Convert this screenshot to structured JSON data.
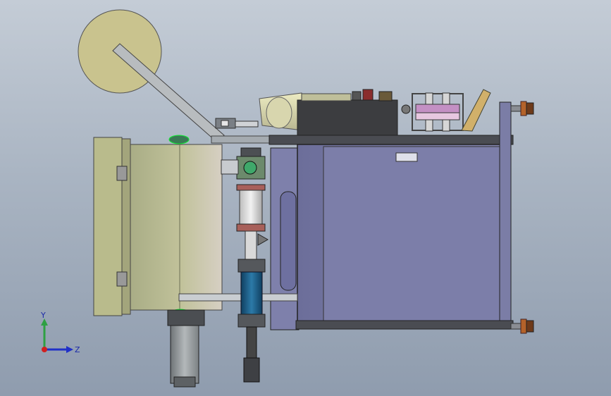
{
  "view": {
    "triad": {
      "y_label": "Y",
      "z_label": "Z",
      "y_color": "#2ea043",
      "z_color": "#2030c8",
      "x_color": "#d02020"
    },
    "colors": {
      "background_top": "#c4ccd6",
      "background_bottom": "#8f9cae",
      "cabinet": "#7b7da6",
      "panel_beige": "#b9bb8c",
      "reel": "#c9c38e",
      "motor": "#9da3a6",
      "dark_box": "#3c3d40",
      "cylinder_blue": "#1c5c86",
      "knob_orange": "#b4622a"
    }
  }
}
